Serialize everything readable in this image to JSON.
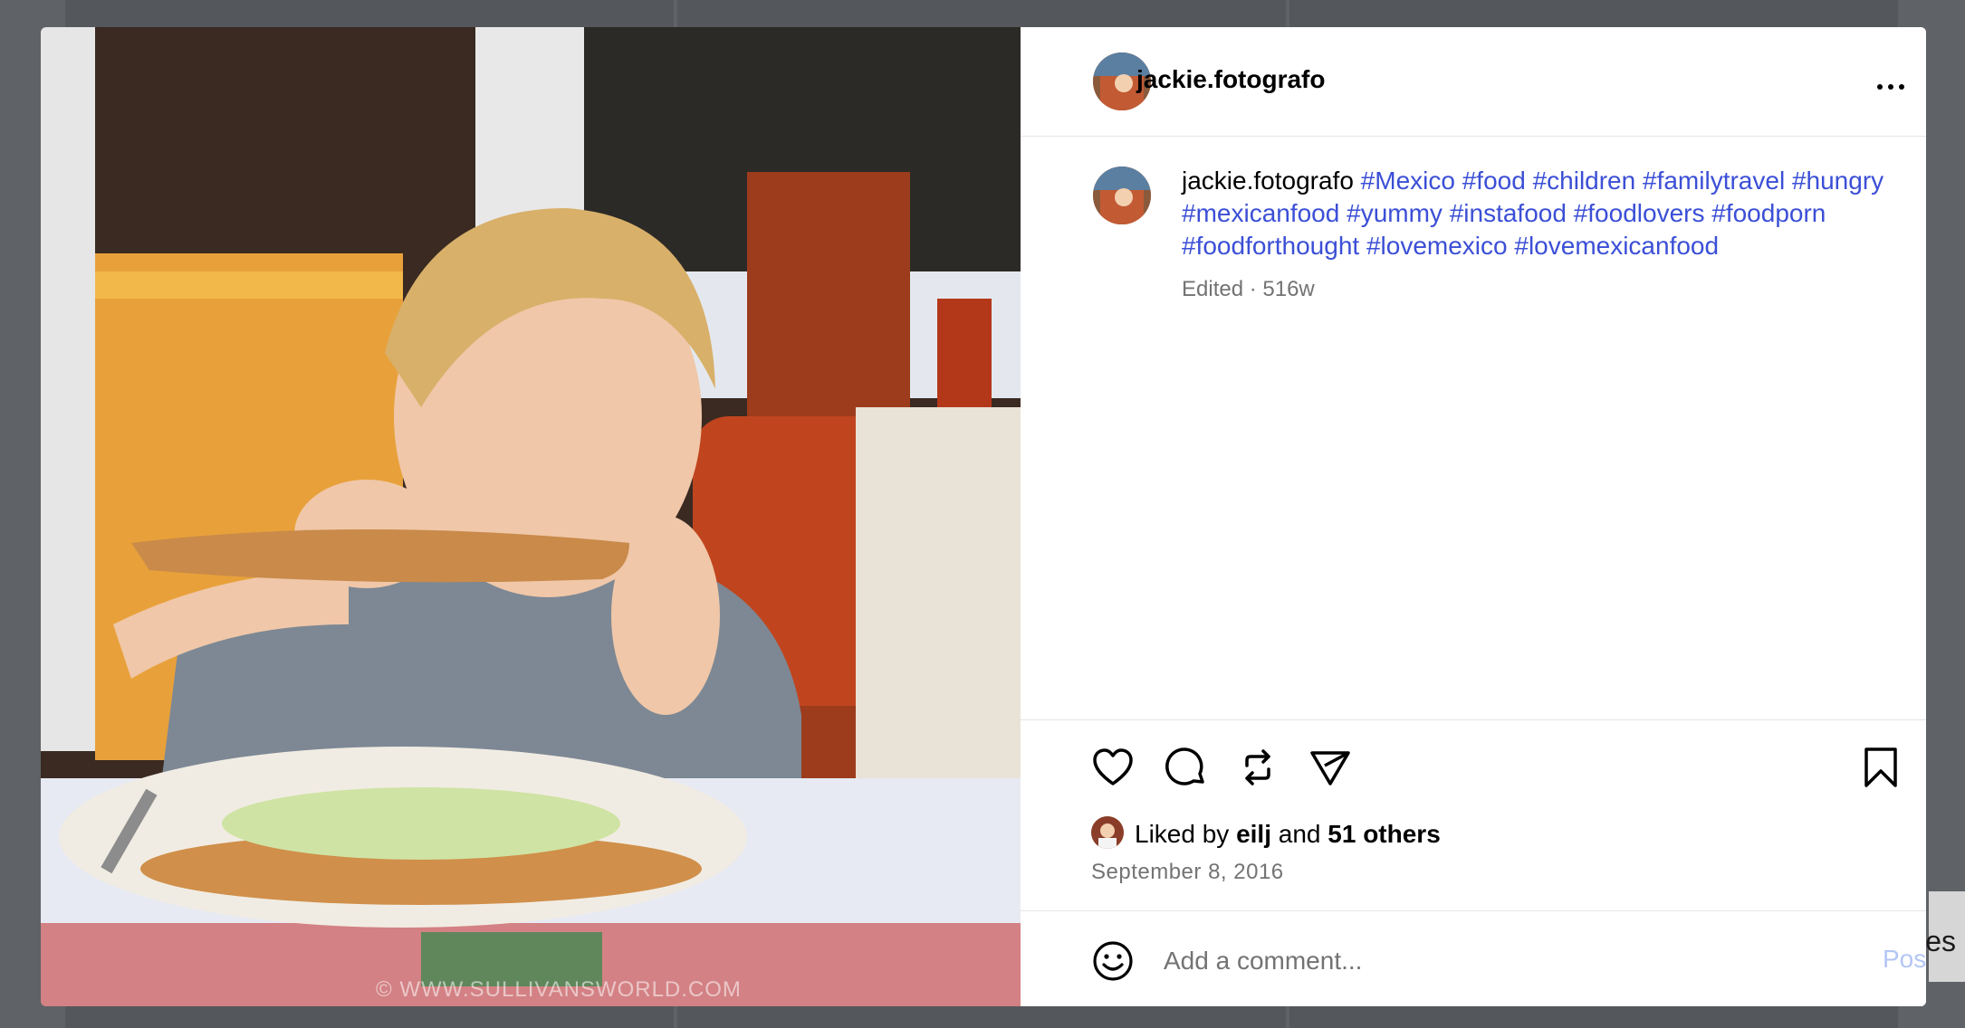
{
  "post": {
    "username": "jackie.fotografo",
    "caption_user": "jackie.fotografo",
    "hashtags": [
      "#Mexico",
      "#food",
      "#children",
      "#familytravel",
      "#hungry",
      "#mexicanfood",
      "#yummy",
      "#instafood",
      "#foodlovers",
      "#foodporn",
      "#foodforthought",
      "#lovemexico",
      "#lovemexicanfood"
    ],
    "meta": "Edited · 516w",
    "watermark": "© WWW.SULLIVANSWORLD.COM"
  },
  "likes": {
    "prefix": "Liked by ",
    "user": "eilj",
    "middle": " and ",
    "others": "51 others"
  },
  "date": "September 8, 2016",
  "comment": {
    "placeholder": "Add a comment...",
    "post_label": "Post"
  },
  "background_text": "es",
  "icons": {
    "more": "more-horizontal-icon",
    "like": "heart-icon",
    "comment": "comment-bubble-icon",
    "repost": "repost-icon",
    "share": "paper-plane-icon",
    "save": "bookmark-icon",
    "emoji": "smiley-icon"
  },
  "colors": {
    "hashtag": "#3b4fd6",
    "post_button_disabled": "#b3c6f5",
    "secondary_text": "#737373"
  }
}
